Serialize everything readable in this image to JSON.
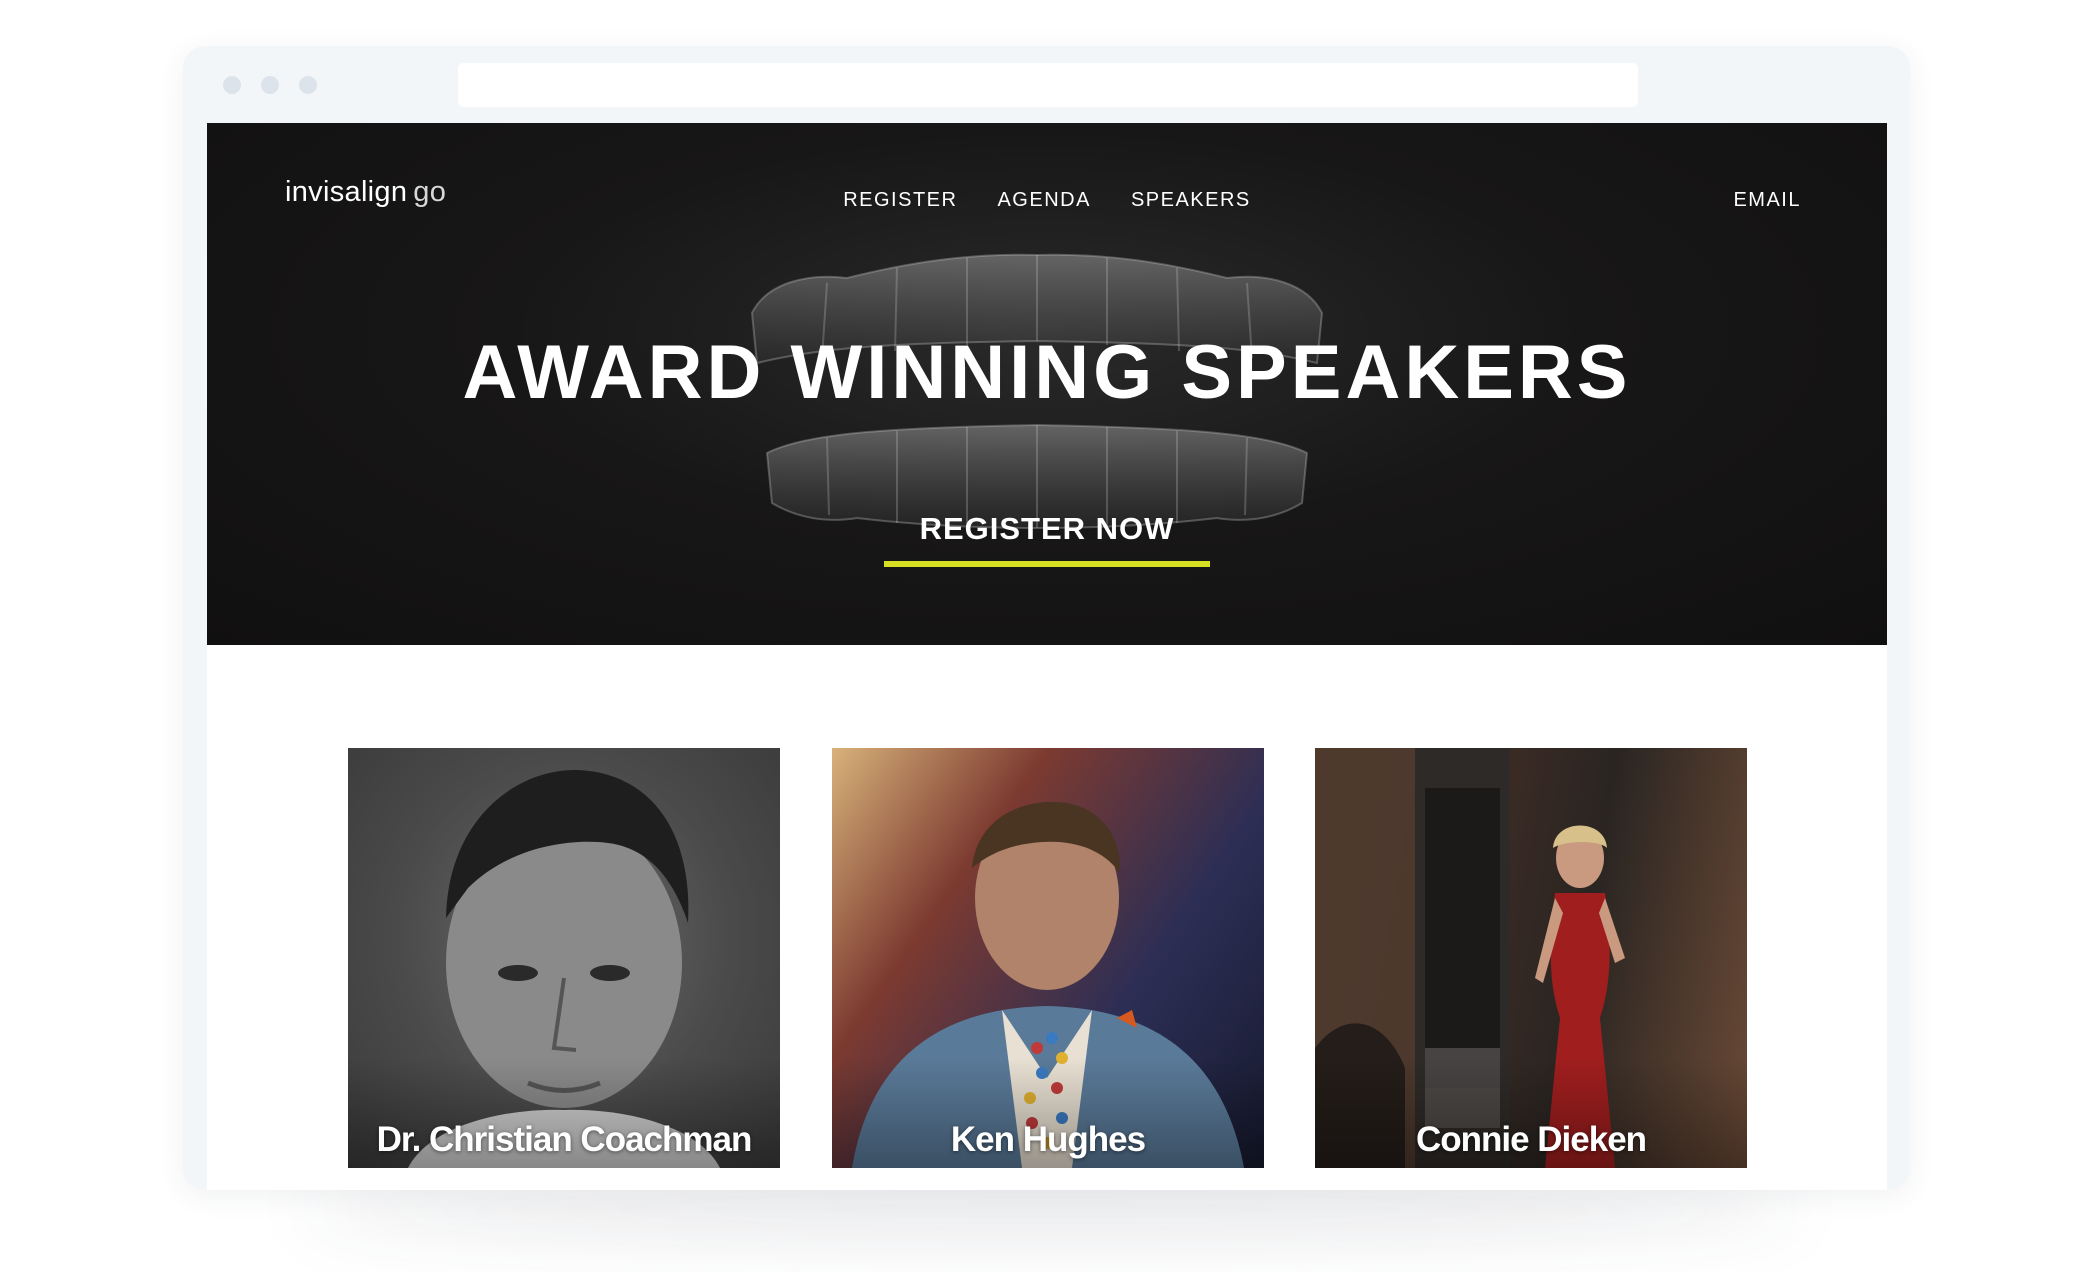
{
  "brand": {
    "name": "invisalign",
    "suffix": "go"
  },
  "nav": {
    "links": [
      {
        "label": "REGISTER"
      },
      {
        "label": "AGENDA"
      },
      {
        "label": "SPEAKERS"
      }
    ],
    "email": "EMAIL"
  },
  "hero": {
    "title": "AWARD WINNING SPEAKERS",
    "cta_label": "REGISTER NOW",
    "accent_color": "#d7df23"
  },
  "speakers": [
    {
      "name": "Dr. Christian Coachman"
    },
    {
      "name": "Ken Hughes"
    },
    {
      "name": "Connie Dieken"
    }
  ]
}
